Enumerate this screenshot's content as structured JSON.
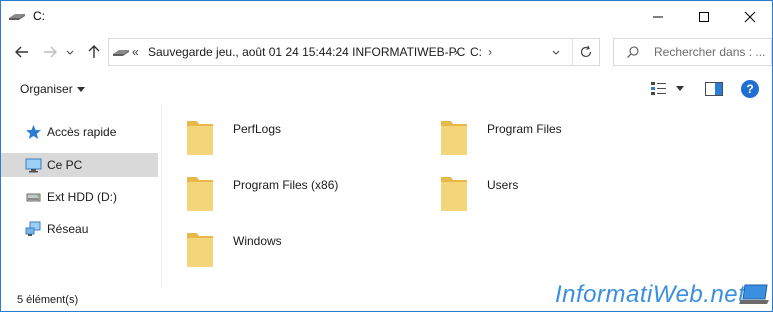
{
  "window": {
    "title": "C:",
    "controls": {
      "minimize": "minimize",
      "maximize": "maximize",
      "close": "close"
    }
  },
  "navigation": {
    "back": "back-arrow",
    "forward": "forward-arrow",
    "recent": "recent-locations",
    "up": "up-arrow"
  },
  "address": {
    "overflow_chevron": "«",
    "segments": [
      "Sauvegarde jeu., août 01 24 15:44:24 INFORMATIWEB-PC",
      "C:"
    ],
    "separator": "›"
  },
  "search": {
    "placeholder": "Rechercher dans : ..."
  },
  "commandbar": {
    "organise_label": "Organiser",
    "help_label": "?"
  },
  "sidebar": {
    "items": [
      {
        "label": "Accès rapide",
        "icon": "star-icon",
        "selected": false
      },
      {
        "label": "Ce PC",
        "icon": "computer-icon",
        "selected": true
      },
      {
        "label": "Ext HDD (D:)",
        "icon": "drive-icon",
        "selected": false
      },
      {
        "label": "Réseau",
        "icon": "network-icon",
        "selected": false
      }
    ]
  },
  "folders": [
    {
      "name": "PerfLogs"
    },
    {
      "name": "Program Files"
    },
    {
      "name": "Program Files (x86)"
    },
    {
      "name": "Users"
    },
    {
      "name": "Windows"
    }
  ],
  "status": {
    "count_text": "5 élément(s)"
  },
  "watermark": {
    "text": "InformatiWeb.net"
  },
  "colors": {
    "accent": "#2b7cd3",
    "folder": "#f4d57a",
    "selection": "#d9d9d9",
    "help": "#1e6fd0"
  }
}
